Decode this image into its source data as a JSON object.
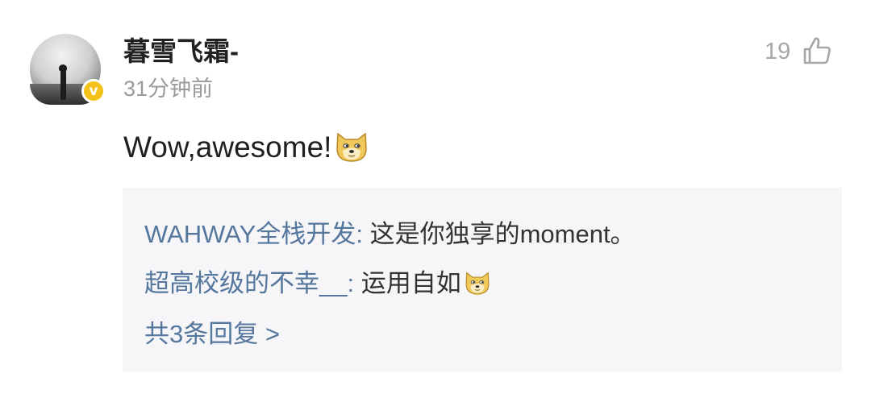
{
  "comment": {
    "username": "暮雪飞霜-",
    "time": "31分钟前",
    "like_count": "19",
    "text": "Wow,awesome!",
    "text_emoji": "doge-icon"
  },
  "replies": {
    "items": [
      {
        "author": "WAHWAY全栈开发",
        "separator": ": ",
        "text": "这是你独享的moment。"
      },
      {
        "author": "超高校级的不幸__",
        "separator": ": ",
        "text": "运用自如",
        "emoji": "doge-icon"
      }
    ],
    "more_label": "共3条回复 >"
  },
  "colors": {
    "link": "#55779e",
    "badge": "#f5c11b",
    "reply_bg": "#f6f6f8"
  }
}
